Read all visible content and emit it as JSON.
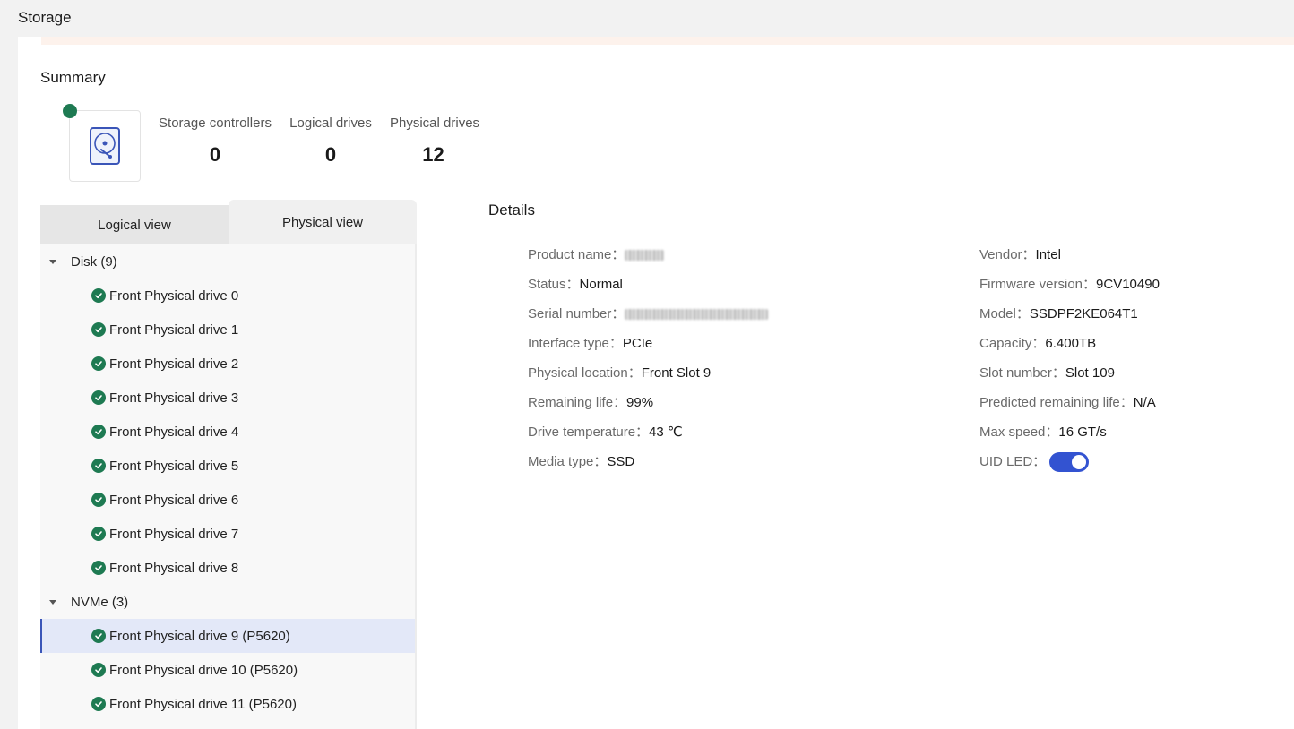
{
  "page": {
    "title": "Storage"
  },
  "summary": {
    "title": "Summary",
    "icon": "hard-drive-icon",
    "status_color": "#1e7a52",
    "stats": [
      {
        "label": "Storage controllers",
        "value": "0"
      },
      {
        "label": "Logical drives",
        "value": "0"
      },
      {
        "label": "Physical drives",
        "value": "12"
      }
    ]
  },
  "tabs": {
    "logical": "Logical view",
    "physical": "Physical view",
    "active": "physical"
  },
  "tree": {
    "groups": [
      {
        "label": "Disk (9)",
        "items": [
          "Front Physical drive 0",
          "Front Physical drive 1",
          "Front Physical drive 2",
          "Front Physical drive 3",
          "Front Physical drive 4",
          "Front Physical drive 5",
          "Front Physical drive 6",
          "Front Physical drive 7",
          "Front Physical drive 8"
        ]
      },
      {
        "label": "NVMe (3)",
        "items": [
          "Front Physical drive 9 (P5620)",
          "Front Physical drive 10 (P5620)",
          "Front Physical drive 11 (P5620)"
        ]
      }
    ],
    "selected": "Front Physical drive 9 (P5620)"
  },
  "details": {
    "title": "Details",
    "left": [
      {
        "label": "Product name：",
        "value": "",
        "redacted": true
      },
      {
        "label": "Status：",
        "value": "Normal"
      },
      {
        "label": "Serial number：",
        "value": "",
        "redacted": true
      },
      {
        "label": "Interface type：",
        "value": "PCIe"
      },
      {
        "label": "Physical location：",
        "value": "Front Slot 9"
      },
      {
        "label": "Remaining life：",
        "value": "99%"
      },
      {
        "label": "Drive temperature：",
        "value": "43 ℃"
      },
      {
        "label": "Media type：",
        "value": "SSD"
      }
    ],
    "right": [
      {
        "label": "Vendor：",
        "value": "Intel"
      },
      {
        "label": "Firmware version：",
        "value": "9CV10490"
      },
      {
        "label": "Model：",
        "value": "SSDPF2KE064T1"
      },
      {
        "label": "Capacity：",
        "value": "6.400TB"
      },
      {
        "label": "Slot number：",
        "value": "Slot 109"
      },
      {
        "label": "Predicted remaining life：",
        "value": "N/A"
      },
      {
        "label": "Max speed：",
        "value": "16 GT/s"
      },
      {
        "label": "UID LED：",
        "value": "",
        "toggle": true,
        "toggle_on": true
      }
    ]
  }
}
